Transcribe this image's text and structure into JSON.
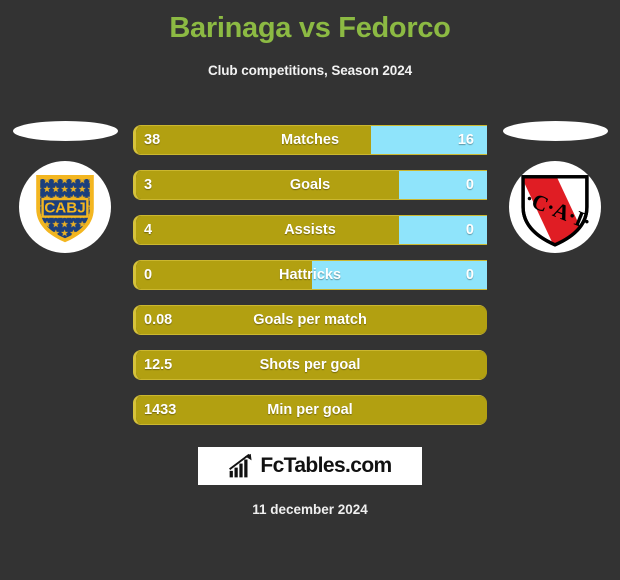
{
  "header": {
    "title": "Barinaga vs Fedorco",
    "subtitle": "Club competitions, Season 2024",
    "title_color": "#8cba43"
  },
  "teams": {
    "home": {
      "crest_name": "boca-juniors-crest",
      "crest_text": "CABJ",
      "colors": {
        "shield": "#1b3f7d",
        "outline": "#f3b620",
        "star": "#f3b620"
      }
    },
    "away": {
      "crest_name": "independiente-crest",
      "crest_text": "·C·A·I·",
      "colors": {
        "shield": "#ffffff",
        "band": "#e01d24",
        "outline": "#000000"
      }
    }
  },
  "colors": {
    "background": "#333333",
    "home_bar": "#b2a011",
    "home_bar_border": "#d6c23a",
    "away_bar": "#8fe4fb",
    "text": "#ffffff"
  },
  "chart_data": {
    "type": "bar",
    "title": "Barinaga vs Fedorco",
    "subtitle": "Club competitions, Season 2024",
    "legend": [
      "Barinaga",
      "Fedorco"
    ],
    "categories": [
      "Matches",
      "Goals",
      "Assists",
      "Hattricks",
      "Goals per match",
      "Shots per goal",
      "Min per goal"
    ],
    "series": [
      {
        "name": "Barinaga",
        "values": [
          38,
          3,
          4,
          0,
          0.08,
          12.5,
          1433
        ]
      },
      {
        "name": "Fedorco",
        "values": [
          16,
          0,
          0,
          0,
          null,
          null,
          null
        ]
      }
    ],
    "rows": [
      {
        "label": "Matches",
        "home": "38",
        "away": "16",
        "home_pct": 67,
        "two_sided": true
      },
      {
        "label": "Goals",
        "home": "3",
        "away": "0",
        "home_pct": 75,
        "two_sided": true
      },
      {
        "label": "Assists",
        "home": "4",
        "away": "0",
        "home_pct": 75,
        "two_sided": true
      },
      {
        "label": "Hattricks",
        "home": "0",
        "away": "0",
        "home_pct": 50,
        "two_sided": true
      },
      {
        "label": "Goals per match",
        "home": "0.08",
        "away": "",
        "home_pct": 100,
        "two_sided": false
      },
      {
        "label": "Shots per goal",
        "home": "12.5",
        "away": "",
        "home_pct": 100,
        "two_sided": false
      },
      {
        "label": "Min per goal",
        "home": "1433",
        "away": "",
        "home_pct": 100,
        "two_sided": false
      }
    ]
  },
  "footer": {
    "logo_text": "FcTables.com",
    "logo_icon": "bar-chart-growth-icon",
    "date": "11 december 2024"
  }
}
